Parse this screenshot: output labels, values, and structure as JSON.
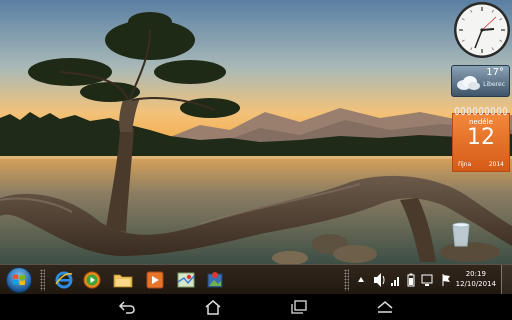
{
  "widgets": {
    "weather": {
      "temperature": "17°",
      "city": "Liberec"
    },
    "calendar": {
      "day_name": "neděle",
      "date": "12",
      "month": "října",
      "year": "2014"
    }
  },
  "taskbar": {
    "pinned": [
      {
        "name": "internet-explorer-icon"
      },
      {
        "name": "media-player-icon"
      },
      {
        "name": "file-explorer-icon"
      },
      {
        "name": "video-player-icon"
      },
      {
        "name": "maps-icon"
      },
      {
        "name": "photos-icon"
      }
    ],
    "clock": {
      "time": "20:19",
      "date": "12/10/2014"
    }
  },
  "colors": {
    "calendar_orange": "#e8702a",
    "taskbar": "#3a2c1f"
  }
}
